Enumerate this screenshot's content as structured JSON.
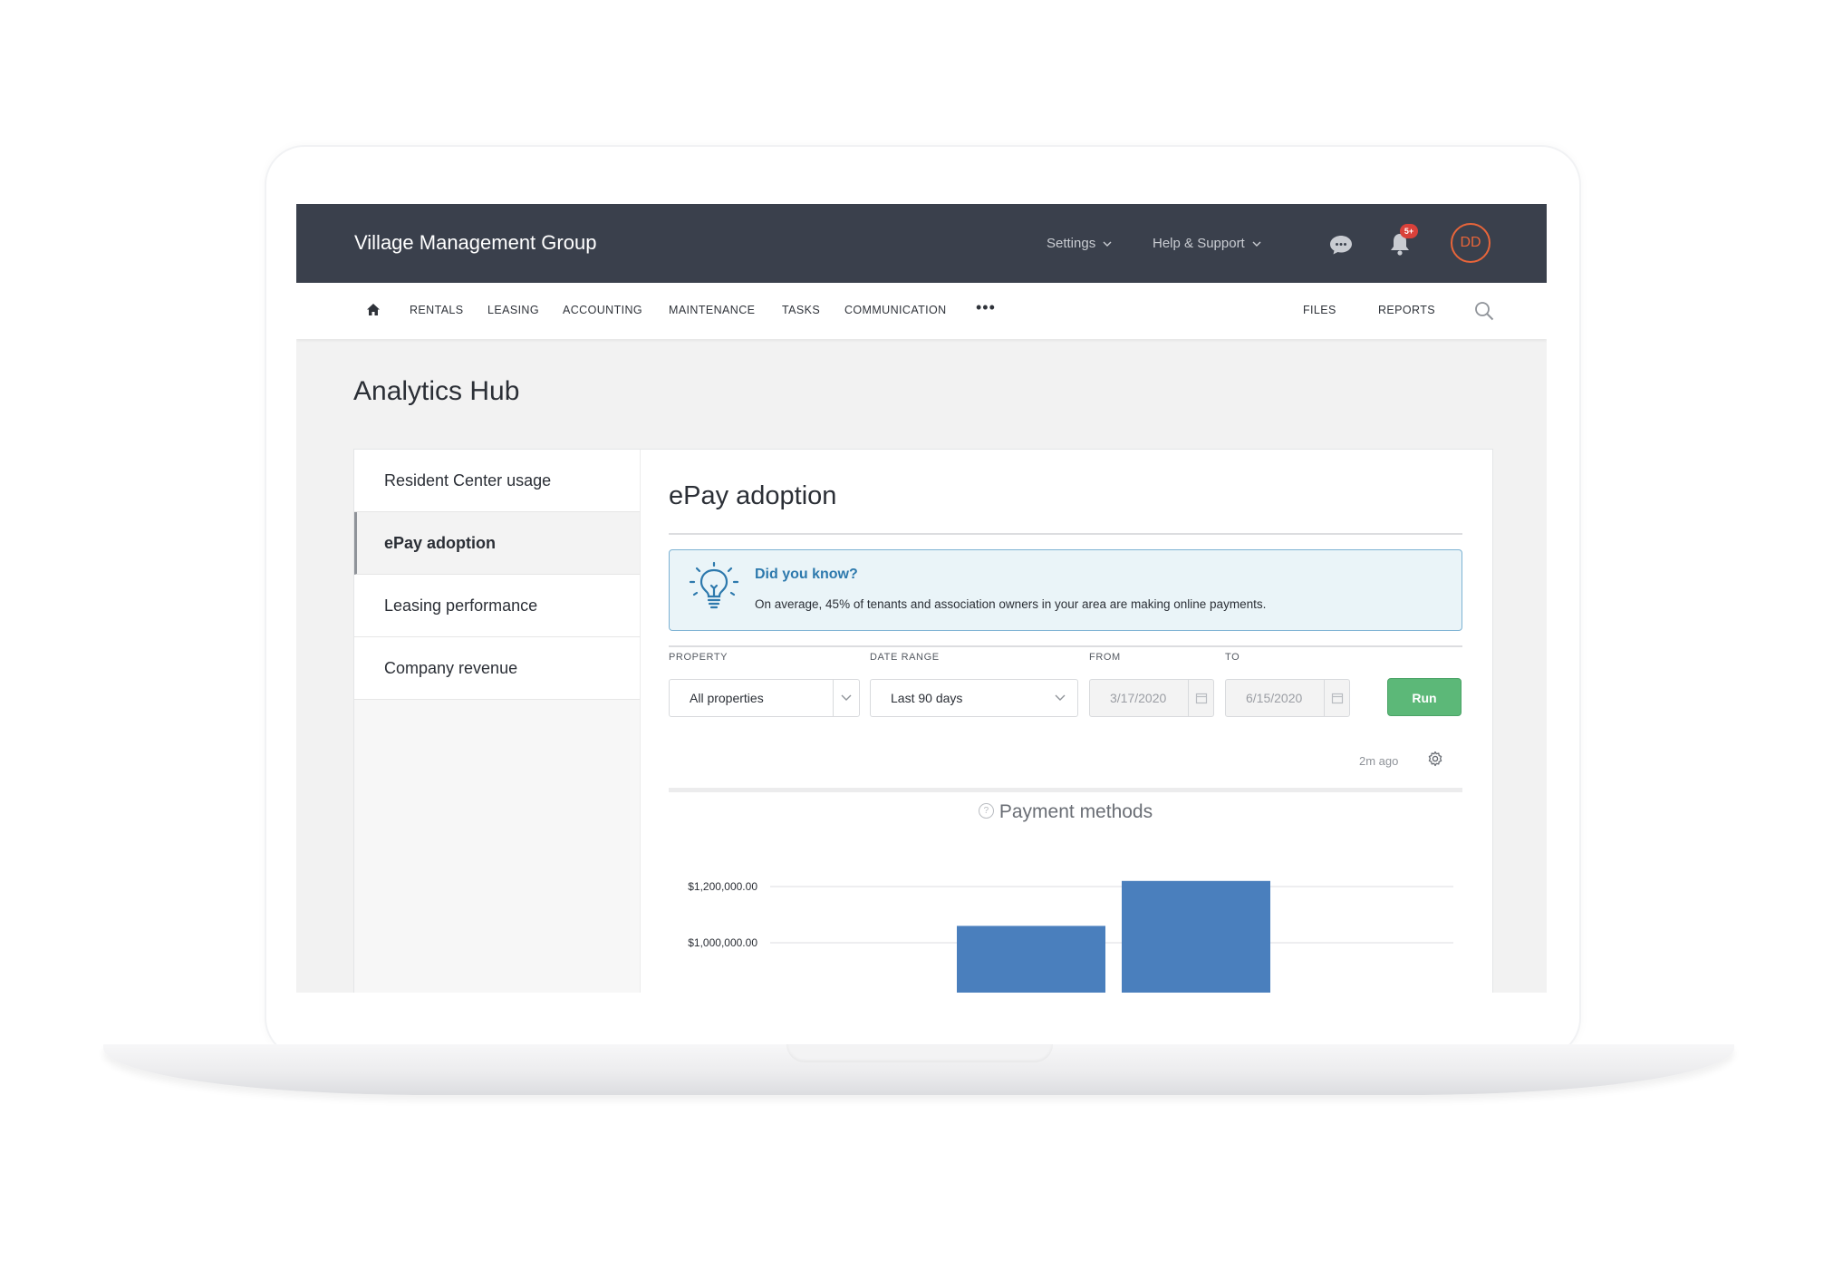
{
  "header": {
    "brand": "Village Management Group",
    "settings_label": "Settings",
    "help_label": "Help & Support",
    "notification_badge": "5+",
    "avatar_initials": "DD"
  },
  "nav": {
    "items": [
      "RENTALS",
      "LEASING",
      "ACCOUNTING",
      "MAINTENANCE",
      "TASKS",
      "COMMUNICATION"
    ],
    "more": "•••",
    "right_items": [
      "FILES",
      "REPORTS"
    ]
  },
  "page": {
    "title": "Analytics Hub"
  },
  "sidebar": {
    "items": [
      {
        "label": "Resident Center usage",
        "active": false
      },
      {
        "label": "ePay adoption",
        "active": true
      },
      {
        "label": "Leasing performance",
        "active": false
      },
      {
        "label": "Company revenue",
        "active": false
      }
    ]
  },
  "main": {
    "title": "ePay adoption",
    "tip": {
      "title": "Did you know?",
      "text": "On average, 45% of tenants and association owners in your area are making online payments."
    },
    "filters": {
      "property_label": "PROPERTY",
      "property_value": "All properties",
      "range_label": "DATE RANGE",
      "range_value": "Last 90 days",
      "from_label": "FROM",
      "from_value": "3/17/2020",
      "to_label": "TO",
      "to_value": "6/15/2020",
      "run_label": "Run"
    },
    "updated": "2m ago"
  },
  "colors": {
    "topbar": "#3a404c",
    "accent_orange": "#e8653a",
    "run_green": "#5cb878",
    "bar_blue": "#4a7fbd",
    "tip_blue": "#2d79ad"
  },
  "chart_data": {
    "type": "bar",
    "title": "Payment methods",
    "yticks": [
      1000000,
      1200000
    ],
    "ytick_labels": [
      "$1,000,000.00",
      "$1,200,000.00"
    ],
    "values": [
      1060000,
      1220000
    ],
    "visible_range": [
      840000,
      1220000
    ]
  }
}
